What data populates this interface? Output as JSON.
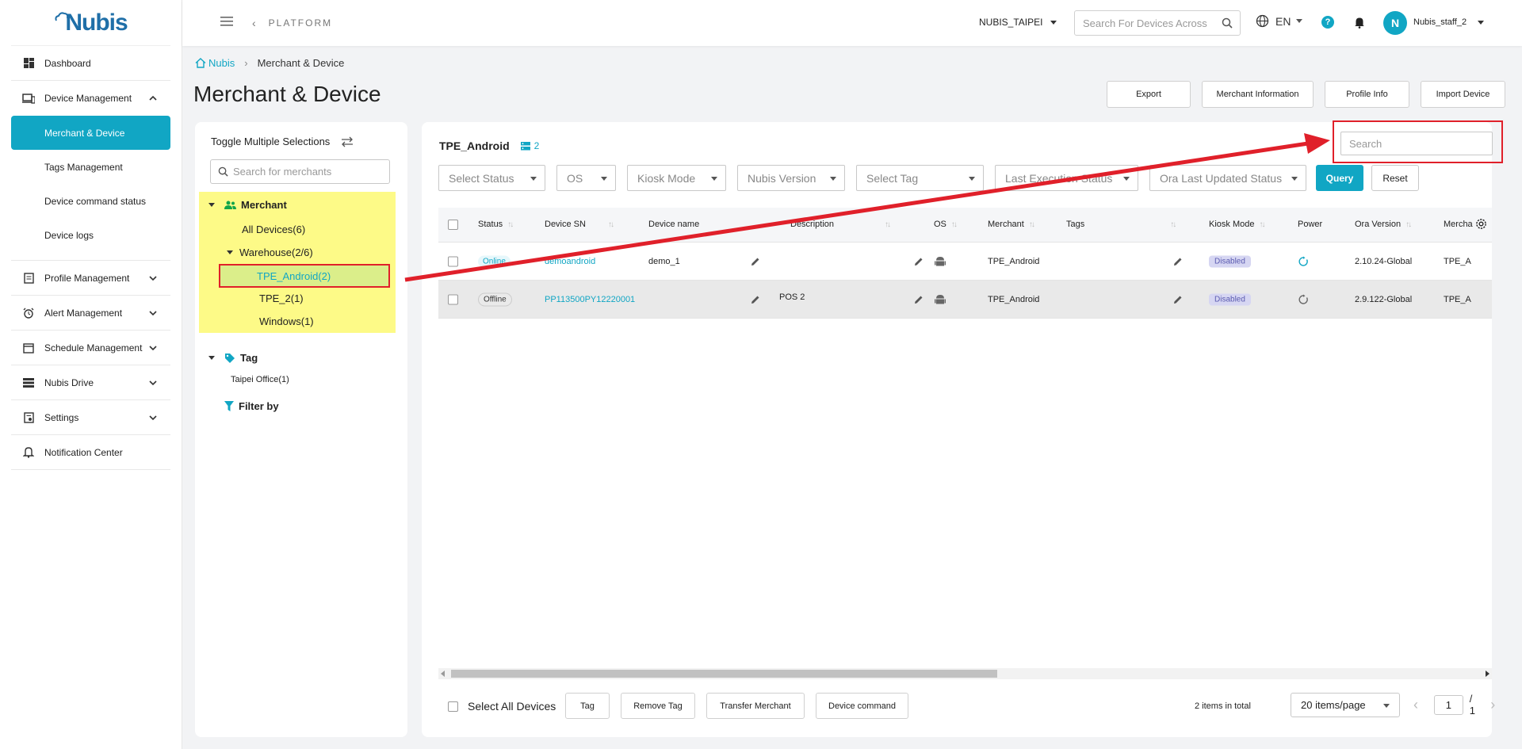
{
  "app": {
    "logo_text": "Nubis"
  },
  "sidebar": {
    "items": [
      {
        "label": "Dashboard",
        "icon": "dashboard-icon"
      },
      {
        "label": "Device Management",
        "icon": "devices-icon",
        "expanded": true,
        "children": [
          "Merchant & Device",
          "Tags Management",
          "Device command status",
          "Device logs"
        ],
        "active_child": "Merchant & Device"
      },
      {
        "label": "Profile Management",
        "icon": "profile-icon"
      },
      {
        "label": "Alert Management",
        "icon": "alarm-icon"
      },
      {
        "label": "Schedule Management",
        "icon": "calendar-icon"
      },
      {
        "label": "Nubis Drive",
        "icon": "drive-icon"
      },
      {
        "label": "Settings",
        "icon": "settings-icon"
      },
      {
        "label": "Notification Center",
        "icon": "bell-icon"
      }
    ]
  },
  "topbar": {
    "platform": "PLATFORM",
    "region": "NUBIS_TAIPEI",
    "search_placeholder": "Search For Devices Across",
    "language": "EN",
    "help": "?",
    "avatar_initial": "N",
    "username": "Nubis_staff_2"
  },
  "breadcrumb": {
    "home": "Nubis",
    "current": "Merchant & Device"
  },
  "page_title": "Merchant & Device",
  "actions": {
    "export": "Export",
    "merchant_info": "Merchant Information",
    "profile_info": "Profile Info",
    "import_device": "Import Device"
  },
  "tree": {
    "toggle_label": "Toggle Multiple Selections",
    "search_placeholder": "Search for merchants",
    "merchant_header": "Merchant",
    "all_devices": "All Devices(6)",
    "warehouse": "Warehouse(2/6)",
    "tpe_android": "TPE_Android(2)",
    "tpe_2": "TPE_2(1)",
    "windows": "Windows(1)",
    "tag_header": "Tag",
    "taipei_office": "Taipei Office(1)",
    "filter_by": "Filter by"
  },
  "main": {
    "merchant_name": "TPE_Android",
    "device_count": "2",
    "search_placeholder": "Search",
    "filters": {
      "status": "Select Status",
      "os": "OS",
      "kiosk": "Kiosk Mode",
      "nubis_version": "Nubis Version",
      "tag": "Select Tag",
      "last_exec": "Last Execution Status",
      "ora_updated": "Ora Last Updated Status",
      "query": "Query",
      "reset": "Reset"
    },
    "columns": {
      "status": "Status",
      "sn": "Device SN",
      "name": "Device name",
      "description": "Description",
      "os": "OS",
      "merchant": "Merchant",
      "tags": "Tags",
      "kiosk": "Kiosk Mode",
      "power": "Power",
      "ora_version": "Ora Version",
      "merchant2": "Mercha"
    },
    "rows": [
      {
        "status": "Online",
        "sn": "demoandroid",
        "name": "demo_1",
        "description": "",
        "merchant": "TPE_Android",
        "kiosk": "Disabled",
        "ora_version": "2.10.24-Global",
        "merchant2": "TPE_A"
      },
      {
        "status": "Offline",
        "sn": "PP113500PY12220001",
        "name": "",
        "description": "POS 2",
        "merchant": "TPE_Android",
        "kiosk": "Disabled",
        "ora_version": "2.9.122-Global",
        "merchant2": "TPE_A"
      }
    ],
    "footer": {
      "select_all": "Select All Devices",
      "tag": "Tag",
      "remove_tag": "Remove Tag",
      "transfer": "Transfer Merchant",
      "device_command": "Device command",
      "total": "2 items in total",
      "page_size": "20 items/page",
      "page": "1",
      "page_total": "/ 1"
    }
  },
  "colors": {
    "accent": "#11a6c4",
    "highlight": "#fdfa87",
    "annotation_red": "#e0202a"
  }
}
